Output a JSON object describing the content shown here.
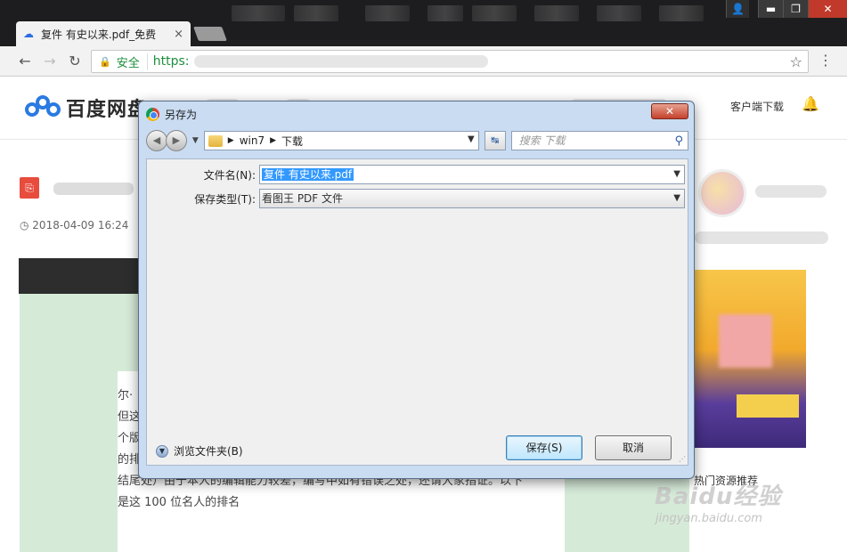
{
  "browser": {
    "tab_title": "复件 有史以来.pdf_免费",
    "tab_close": "×",
    "secure_label": "安全",
    "url_prefix": "https:",
    "window_controls": [
      "▬",
      "❐",
      "✕"
    ]
  },
  "site": {
    "logo_text": "百度网盘",
    "client_download": "客户端下载",
    "doc_date": "2018-04-09 16:24",
    "article_lines": [
      "尔·",
      "但这",
      "个版",
      "的排",
      "结尾处）由于本人的编辑能力较差，编写中如有错误之处，还请大家指证。以下",
      "是这 100 位名人的排名"
    ],
    "sidebar_hot": "热门资源推荐",
    "watermark": "Baidu经验",
    "watermark_sub": "jingyan.baidu.com"
  },
  "dialog": {
    "title": "另存为",
    "close_label": "✕",
    "breadcrumb": [
      "win7",
      "下载"
    ],
    "search_placeholder": "搜索 下载",
    "filename_label": "文件名(N):",
    "filename_value": "复件 有史以来.pdf",
    "filetype_label": "保存类型(T):",
    "filetype_value": "看图王 PDF 文件",
    "browse_label": "浏览文件夹(B)",
    "save_label": "保存(S)",
    "cancel_label": "取消"
  },
  "colors": {
    "accent_blue": "#2a7ae2",
    "secure_green": "#1e8e3e",
    "pdf_red": "#e84c3d",
    "selection_blue": "#3399ff"
  }
}
